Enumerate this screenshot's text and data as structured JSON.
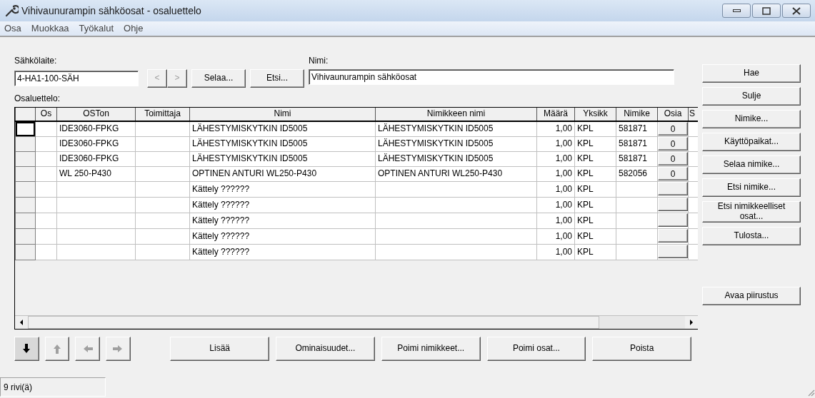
{
  "window": {
    "title": "Vihivaunurampin sähköosat - osaluettelo"
  },
  "menu": [
    "Osa",
    "Muokkaa",
    "Työkalut",
    "Ohje"
  ],
  "device": {
    "label": "Sähkölaite:",
    "value": "4-HA1-100-SÄH"
  },
  "nav_buttons": [
    {
      "label": "<",
      "disabled": true
    },
    {
      "label": ">",
      "disabled": true
    }
  ],
  "header_buttons": [
    "Selaa...",
    "Etsi..."
  ],
  "name": {
    "label": "Nimi:",
    "value": "Vihivaunurampin sähköosat"
  },
  "list_label": "Osaluettelo:",
  "table": {
    "columns": [
      "Os",
      "OSTon",
      "Toimittaja",
      "Nimi",
      "Nimikkeen nimi",
      "Määrä",
      "Yksikk",
      "Nimike",
      "Osia",
      "S"
    ],
    "rows": [
      {
        "oston": "IDE3060-FPKG",
        "nimi": "LÄHESTYMISKYTKIN ID5005",
        "nimikkeen_nimi": "LÄHESTYMISKYTKIN ID5005",
        "maara": "1,00",
        "yksikko": "KPL",
        "nimike": "581871",
        "osia": "0",
        "current": true
      },
      {
        "oston": "IDE3060-FPKG",
        "nimi": "LÄHESTYMISKYTKIN ID5005",
        "nimikkeen_nimi": "LÄHESTYMISKYTKIN ID5005",
        "maara": "1,00",
        "yksikko": "KPL",
        "nimike": "581871",
        "osia": "0",
        "current": false
      },
      {
        "oston": "IDE3060-FPKG",
        "nimi": "LÄHESTYMISKYTKIN ID5005",
        "nimikkeen_nimi": "LÄHESTYMISKYTKIN ID5005",
        "maara": "1,00",
        "yksikko": "KPL",
        "nimike": "581871",
        "osia": "0",
        "current": false
      },
      {
        "oston": "WL 250-P430",
        "nimi": "OPTINEN ANTURI WL250-P430",
        "nimikkeen_nimi": "OPTINEN ANTURI WL250-P430",
        "maara": "1,00",
        "yksikko": "KPL",
        "nimike": "582056",
        "osia": "0",
        "current": false
      },
      {
        "nimi": "Kättely  ??????",
        "maara": "1,00",
        "yksikko": "KPL",
        "current": false
      },
      {
        "nimi": "Kättely  ??????",
        "maara": "1,00",
        "yksikko": "KPL",
        "current": false
      },
      {
        "nimi": "Kättely  ??????",
        "maara": "1,00",
        "yksikko": "KPL",
        "current": false
      },
      {
        "nimi": "Kättely  ??????",
        "maara": "1,00",
        "yksikko": "KPL",
        "current": false
      },
      {
        "nimi": "Kättely  ??????",
        "maara": "1,00",
        "yksikko": "KPL",
        "current": false
      }
    ]
  },
  "side_buttons": [
    "Hae",
    "Sulje",
    "Nimike...",
    "Käyttöpaikat...",
    "Selaa nimike...",
    "Etsi nimike...",
    "Etsi nimikkeelliset osat...",
    "Tulosta..."
  ],
  "side_buttons_lower": [
    "Avaa piirustus"
  ],
  "move_buttons": [
    {
      "kind": "down",
      "disabled": false
    },
    {
      "kind": "up",
      "disabled": true
    },
    {
      "kind": "left",
      "disabled": true
    },
    {
      "kind": "right",
      "disabled": true
    }
  ],
  "action_buttons": [
    "Lisää",
    "Ominaisuudet...",
    "Poimi nimikkeet...",
    "Poimi osat...",
    "Poista"
  ],
  "status_bar": {
    "text": "9 rivi(ä)"
  }
}
